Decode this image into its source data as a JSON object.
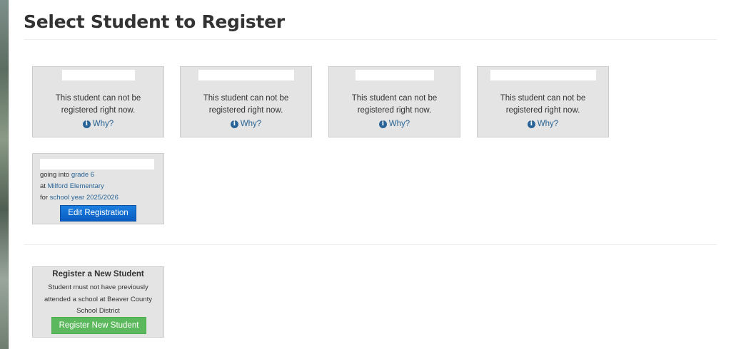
{
  "page": {
    "title": "Select Student to Register"
  },
  "blocked_students": [
    {
      "message": "This student can not be registered right now.",
      "why_label": "Why?"
    },
    {
      "message": "This student can not be registered right now.",
      "why_label": "Why?"
    },
    {
      "message": "This student can not be registered right now.",
      "why_label": "Why?"
    },
    {
      "message": "This student can not be registered right now.",
      "why_label": "Why?"
    }
  ],
  "registered_student": {
    "going_into_prefix": "going into",
    "grade": "grade 6",
    "at_prefix": "at",
    "school": "Milford Elementary",
    "for_prefix": "for",
    "school_year": "school year 2025/2026",
    "edit_button": "Edit Registration"
  },
  "new_student": {
    "title": "Register a New Student",
    "description": "Student must not have previously attended a school at Beaver County School District",
    "button": "Register New Student"
  },
  "colors": {
    "card_bg": "#e4e4e4",
    "link": "#2a6496",
    "edit_button": "#0a5cc2",
    "new_button": "#5cb85c"
  },
  "icons": {
    "why": "info-circle-icon"
  }
}
